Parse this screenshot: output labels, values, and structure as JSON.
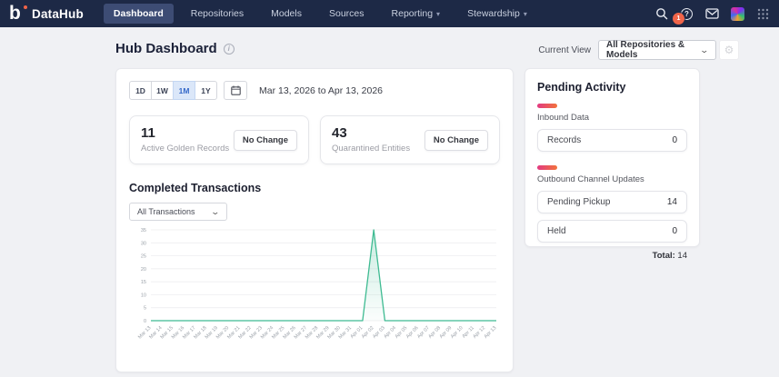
{
  "brand": {
    "name": "DataHub",
    "logo_letter": "b"
  },
  "nav": {
    "items": [
      {
        "label": "Dashboard",
        "active": true
      },
      {
        "label": "Repositories",
        "active": false
      },
      {
        "label": "Models",
        "active": false
      },
      {
        "label": "Sources",
        "active": false
      },
      {
        "label": "Reporting",
        "active": false,
        "caret": true
      },
      {
        "label": "Stewardship",
        "active": false,
        "caret": true
      }
    ],
    "notification_badge": "1",
    "icons": {
      "search": "magnifier",
      "help": "question-circle",
      "mail": "envelope",
      "avatar": "user-mosaic",
      "apps": "grid-3x3"
    }
  },
  "page": {
    "title": "Hub Dashboard",
    "current_view_label": "Current View",
    "current_view_value": "All Repositories & Models"
  },
  "date_range": {
    "options": [
      "1D",
      "1W",
      "1M",
      "1Y"
    ],
    "active": "1M",
    "range_text": "Mar 13, 2026 to Apr 13, 2026"
  },
  "stats": [
    {
      "value": "11",
      "label": "Active Golden Records",
      "change": "No Change"
    },
    {
      "value": "43",
      "label": "Quarantined Entities",
      "change": "No Change"
    }
  ],
  "transactions": {
    "title": "Completed Transactions",
    "filter_value": "All Transactions"
  },
  "chart_data": {
    "type": "area",
    "title": "Completed Transactions",
    "x": [
      "Mar 13",
      "Mar 14",
      "Mar 15",
      "Mar 16",
      "Mar 17",
      "Mar 18",
      "Mar 19",
      "Mar 20",
      "Mar 21",
      "Mar 22",
      "Mar 23",
      "Mar 24",
      "Mar 25",
      "Mar 26",
      "Mar 27",
      "Mar 28",
      "Mar 29",
      "Mar 30",
      "Mar 31",
      "Apr 01",
      "Apr 02",
      "Apr 03",
      "Apr 04",
      "Apr 05",
      "Apr 06",
      "Apr 07",
      "Apr 08",
      "Apr 09",
      "Apr 10",
      "Apr 11",
      "Apr 12",
      "Apr 13"
    ],
    "values": [
      0,
      0,
      0,
      0,
      0,
      0,
      0,
      0,
      0,
      0,
      0,
      0,
      0,
      0,
      0,
      0,
      0,
      0,
      0,
      0,
      35,
      0,
      0,
      0,
      0,
      0,
      0,
      0,
      0,
      0,
      0,
      0
    ],
    "ylim": [
      0,
      35
    ],
    "yticks": [
      0,
      5,
      10,
      15,
      20,
      25,
      30,
      35
    ],
    "grid": true,
    "legend": "none",
    "line_color": "#3fbb92",
    "fill_color": "#3fbb92"
  },
  "pending": {
    "title": "Pending Activity",
    "sections": [
      {
        "label": "Inbound Data",
        "rows": [
          {
            "name": "Records",
            "value": "0"
          }
        ]
      },
      {
        "label": "Outbound Channel Updates",
        "rows": [
          {
            "name": "Pending Pickup",
            "value": "14"
          },
          {
            "name": "Held",
            "value": "0"
          }
        ]
      }
    ],
    "total_label": "Total:",
    "total_value": "14"
  },
  "colors": {
    "navbar_bg": "#1d2946",
    "nav_active_bg": "#3d4c74",
    "badge": "#f06449",
    "page_bg": "#f0f1f4",
    "accent_green": "#3fbb92",
    "active_range_bg": "#dbe7f9",
    "active_range_text": "#3569c9",
    "pill_gradient_start": "#e23a82",
    "pill_gradient_end": "#f2733c"
  }
}
